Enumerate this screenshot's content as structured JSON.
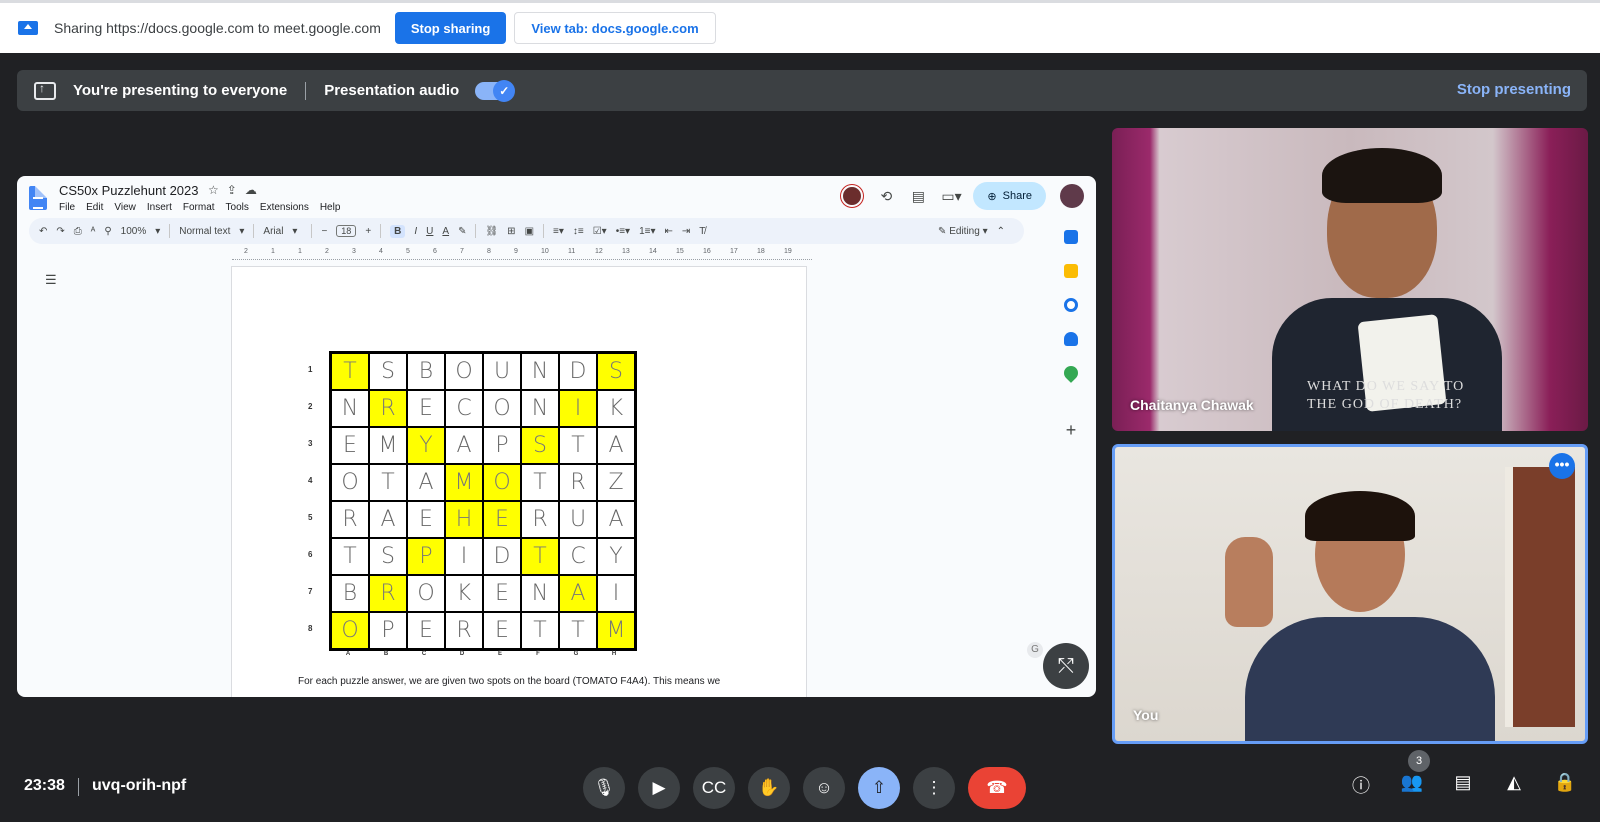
{
  "sharing_bar": {
    "text": "Sharing https://docs.google.com to meet.google.com",
    "stop_label": "Stop sharing",
    "view_tab_label": "View tab: docs.google.com"
  },
  "presenting_bar": {
    "title": "You're presenting to everyone",
    "audio_label": "Presentation audio",
    "audio_on": true,
    "stop_label": "Stop presenting"
  },
  "docs": {
    "title": "CS50x Puzzlehunt 2023",
    "menu": [
      "File",
      "Edit",
      "View",
      "Insert",
      "Format",
      "Tools",
      "Extensions",
      "Help"
    ],
    "share_label": "Share",
    "toolbar": {
      "zoom": "100%",
      "style": "Normal text",
      "font": "Arial",
      "font_size": "18",
      "mode": "Editing"
    },
    "ruler_numbers": [
      "2",
      "1",
      "1",
      "2",
      "3",
      "4",
      "5",
      "6",
      "7",
      "8",
      "9",
      "10",
      "11",
      "12",
      "13",
      "14",
      "15",
      "16",
      "17",
      "18",
      "19"
    ],
    "puzzle": {
      "row_labels": [
        "1",
        "2",
        "3",
        "4",
        "5",
        "6",
        "7",
        "8"
      ],
      "col_labels": [
        "A",
        "B",
        "C",
        "D",
        "E",
        "F",
        "G",
        "H"
      ],
      "rows": [
        [
          "T",
          "S",
          "B",
          "O",
          "U",
          "N",
          "D",
          "S"
        ],
        [
          "N",
          "R",
          "E",
          "C",
          "O",
          "N",
          "I",
          "K"
        ],
        [
          "E",
          "M",
          "Y",
          "A",
          "P",
          "S",
          "T",
          "A"
        ],
        [
          "O",
          "T",
          "A",
          "M",
          "O",
          "T",
          "R",
          "Z"
        ],
        [
          "R",
          "A",
          "E",
          "H",
          "E",
          "R",
          "U",
          "A"
        ],
        [
          "T",
          "S",
          "P",
          "I",
          "D",
          "T",
          "C",
          "Y"
        ],
        [
          "B",
          "R",
          "O",
          "K",
          "E",
          "N",
          "A",
          "I"
        ],
        [
          "O",
          "P",
          "E",
          "R",
          "E",
          "T",
          "T",
          "M"
        ]
      ],
      "highlighted": [
        "0-0",
        "0-7",
        "1-1",
        "1-6",
        "2-2",
        "2-5",
        "3-3",
        "3-4",
        "4-3",
        "4-4",
        "5-2",
        "5-5",
        "6-1",
        "6-6",
        "7-0",
        "7-7"
      ],
      "highlight_color": "#ffff00"
    },
    "paragraph": "For each puzzle answer, we are given two spots on the board (TOMATO F4A4). This means we"
  },
  "participants": [
    {
      "name": "Chaitanya Chawak",
      "shirt_text_1": "WHAT DO WE SAY TO",
      "shirt_text_2": "THE GOD OF DEATH?"
    },
    {
      "name": "You"
    }
  ],
  "bottom_bar": {
    "time": "23:38",
    "meeting_code": "uvq-orih-npf",
    "participant_count": "3"
  },
  "colors": {
    "accent": "#1a73e8",
    "light_accent": "#8ab4f8",
    "end_call": "#ea4335",
    "background": "#202124"
  }
}
